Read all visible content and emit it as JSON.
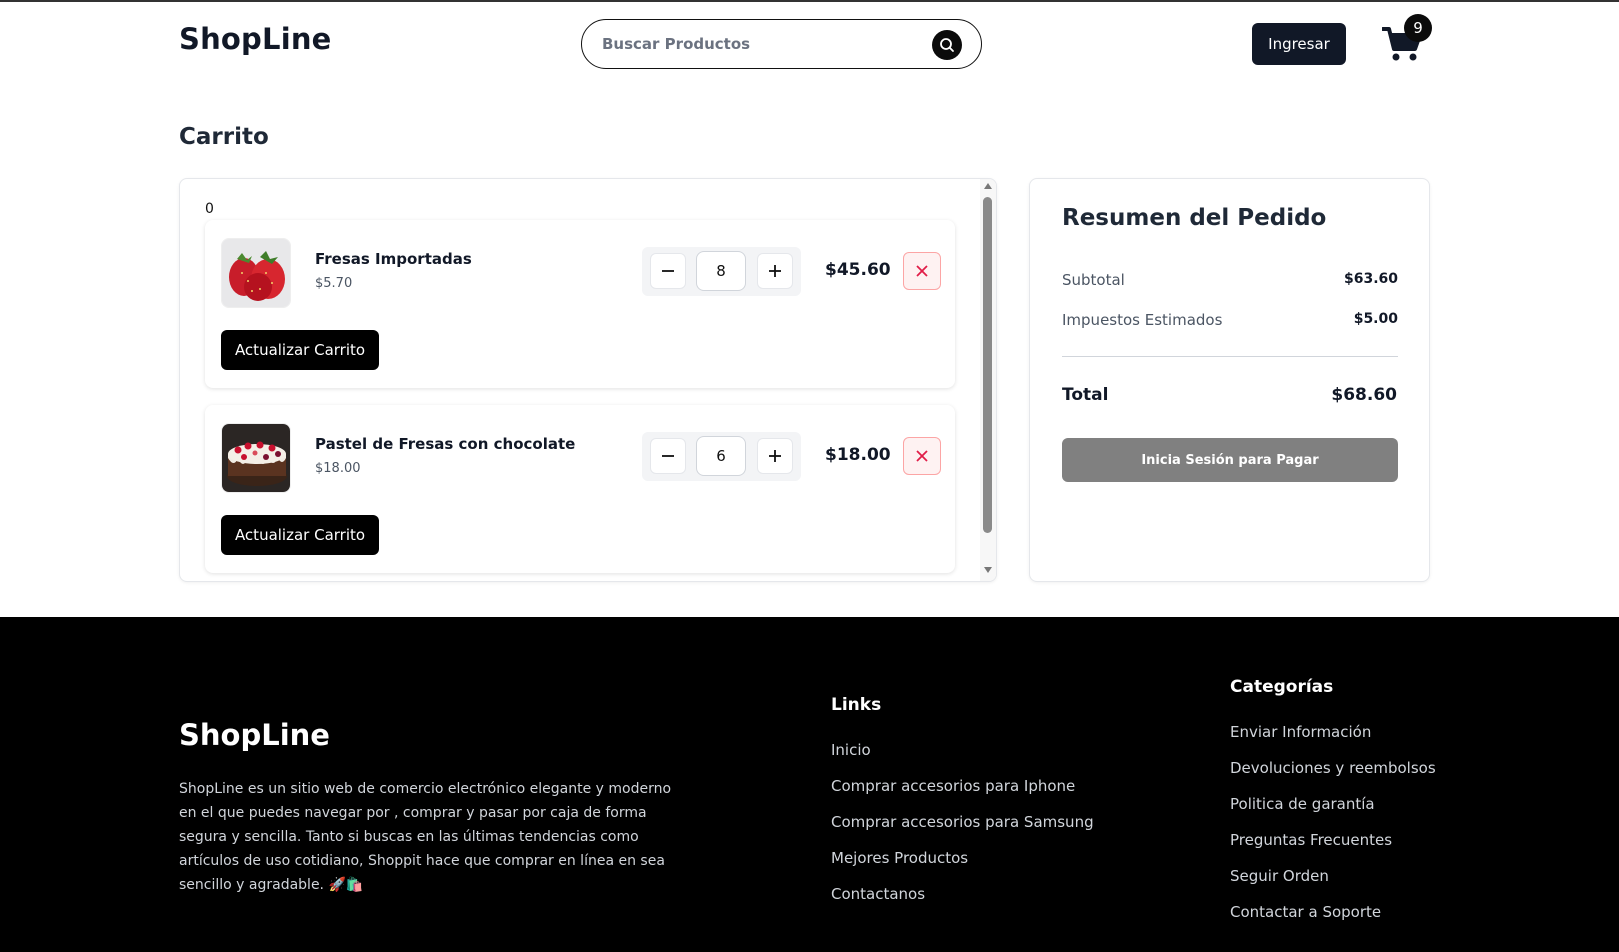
{
  "header": {
    "logo": "ShopLine",
    "search_placeholder": "Buscar Productos",
    "login_label": "Ingresar",
    "cart_count": "9"
  },
  "cart": {
    "title": "Carrito",
    "index_label": "0",
    "items": [
      {
        "name": "Fresas Importadas",
        "unit_price": "$5.70",
        "quantity": "8",
        "total": "$45.60",
        "update_label": "Actualizar Carrito",
        "image_icon": "strawberry-image"
      },
      {
        "name": "Pastel de Fresas con chocolate",
        "unit_price": "$18.00",
        "quantity": "6",
        "total": "$18.00",
        "update_label": "Actualizar Carrito",
        "image_icon": "cake-image"
      }
    ]
  },
  "summary": {
    "title": "Resumen del Pedido",
    "subtotal_label": "Subtotal",
    "subtotal_value": "$63.60",
    "tax_label": "Impuestos Estimados",
    "tax_value": "$5.00",
    "total_label": "Total",
    "total_value": "$68.60",
    "pay_label": "Inicia Sesión para Pagar"
  },
  "footer": {
    "logo": "ShopLine",
    "description": "ShopLine es un sitio web de comercio electrónico elegante y moderno en el que puedes navegar por , comprar y pasar por caja de forma segura y sencilla. Tanto si buscas en las últimas tendencias como artículos de uso cotidiano, Shoppit hace que comprar en línea en sea sencillo y agradable. 🚀🛍️",
    "links_title": "Links",
    "links": [
      "Inicio",
      "Comprar accesorios para Iphone",
      "Comprar accesorios para Samsung",
      "Mejores Productos",
      "Contactanos"
    ],
    "categories_title": "Categorías",
    "categories": [
      "Enviar Información",
      "Devoluciones y reembolsos",
      "Politica de garantía",
      "Preguntas Frecuentes",
      "Seguir Orden",
      "Contactar a Soporte"
    ]
  },
  "colors": {
    "dark": "#111827",
    "footer_bg": "#000000",
    "pay_button": "#808080",
    "remove_red": "#e11d48"
  }
}
